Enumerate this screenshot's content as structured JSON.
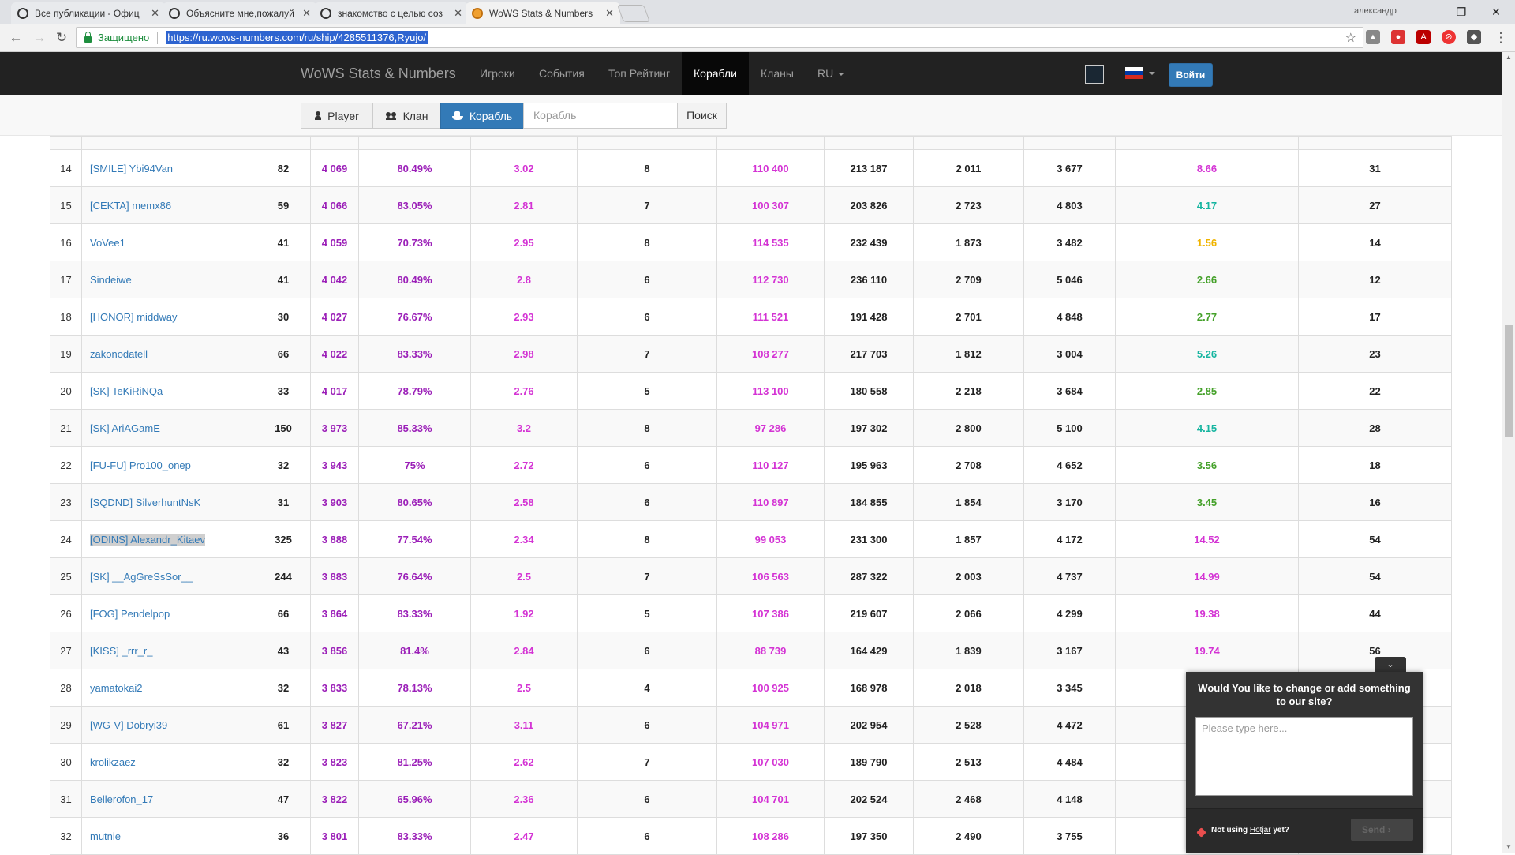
{
  "browser": {
    "tabs": [
      {
        "title": "Все публикации - Офиц",
        "favicon": "wows-icon"
      },
      {
        "title": "Объясните мне,пожалуй",
        "favicon": "wows-icon"
      },
      {
        "title": "знакомство с целью соз",
        "favicon": "wows-icon"
      },
      {
        "title": "WoWS Stats & Numbers",
        "favicon": "numbers-icon"
      }
    ],
    "user": "александр",
    "secure_label": "Защищено",
    "url": "https://ru.wows-numbers.com/ru/ship/4285511376,Ryujo/"
  },
  "site": {
    "brand": "WoWS Stats & Numbers",
    "nav": [
      "Игроки",
      "События",
      "Топ Рейтинг",
      "Корабли",
      "Кланы",
      "RU"
    ],
    "active_nav": "Корабли",
    "login": "Войти"
  },
  "search": {
    "player": "Player",
    "clan": "Клан",
    "ship": "Корабль",
    "placeholder": "Корабль",
    "go": "Поиск"
  },
  "table": {
    "rows": [
      {
        "rank": "14",
        "nick": "[SMILE] Ybi94Van",
        "battles": "82",
        "pr": "4 069",
        "wr": "80.49%",
        "frags": "3.02",
        "c5": "8",
        "dmg": "110 400",
        "c7": "213 187",
        "c8": "2 011",
        "c9": "3 677",
        "c10": "8.66",
        "c10_color": "#d433d4",
        "c11": "31"
      },
      {
        "rank": "15",
        "nick": "[CEKTA] memx86",
        "battles": "59",
        "pr": "4 066",
        "wr": "83.05%",
        "frags": "2.81",
        "c5": "7",
        "dmg": "100 307",
        "c7": "203 826",
        "c8": "2 723",
        "c9": "4 803",
        "c10": "4.17",
        "c10_color": "#16b5a0",
        "c11": "27"
      },
      {
        "rank": "16",
        "nick": "VoVee1",
        "battles": "41",
        "pr": "4 059",
        "wr": "70.73%",
        "frags": "2.95",
        "c5": "8",
        "dmg": "114 535",
        "c7": "232 439",
        "c8": "1 873",
        "c9": "3 482",
        "c10": "1.56",
        "c10_color": "#f0b400",
        "c11": "14"
      },
      {
        "rank": "17",
        "nick": "Sindeiwe",
        "battles": "41",
        "pr": "4 042",
        "wr": "80.49%",
        "frags": "2.8",
        "c5": "6",
        "dmg": "112 730",
        "c7": "236 110",
        "c8": "2 709",
        "c9": "5 046",
        "c10": "2.66",
        "c10_color": "#45a12a",
        "c11": "12"
      },
      {
        "rank": "18",
        "nick": "[HONOR] middway",
        "battles": "30",
        "pr": "4 027",
        "wr": "76.67%",
        "frags": "2.93",
        "c5": "6",
        "dmg": "111 521",
        "c7": "191 428",
        "c8": "2 701",
        "c9": "4 848",
        "c10": "2.77",
        "c10_color": "#45a12a",
        "c11": "17"
      },
      {
        "rank": "19",
        "nick": "zakonodatell",
        "battles": "66",
        "pr": "4 022",
        "wr": "83.33%",
        "frags": "2.98",
        "c5": "7",
        "dmg": "108 277",
        "c7": "217 703",
        "c8": "1 812",
        "c9": "3 004",
        "c10": "5.26",
        "c10_color": "#16b5a0",
        "c11": "23"
      },
      {
        "rank": "20",
        "nick": "[SK] TeKiRiNQa",
        "battles": "33",
        "pr": "4 017",
        "wr": "78.79%",
        "frags": "2.76",
        "c5": "5",
        "dmg": "113 100",
        "c7": "180 558",
        "c8": "2 218",
        "c9": "3 684",
        "c10": "2.85",
        "c10_color": "#45a12a",
        "c11": "22"
      },
      {
        "rank": "21",
        "nick": "[SK] AriAGamE",
        "battles": "150",
        "pr": "3 973",
        "wr": "85.33%",
        "frags": "3.2",
        "c5": "8",
        "dmg": "97 286",
        "c7": "197 302",
        "c8": "2 800",
        "c9": "5 100",
        "c10": "4.15",
        "c10_color": "#16b5a0",
        "c11": "28"
      },
      {
        "rank": "22",
        "nick": "[FU-FU] Pro100_onep",
        "battles": "32",
        "pr": "3 943",
        "wr": "75%",
        "frags": "2.72",
        "c5": "6",
        "dmg": "110 127",
        "c7": "195 963",
        "c8": "2 708",
        "c9": "4 652",
        "c10": "3.56",
        "c10_color": "#45a12a",
        "c11": "18"
      },
      {
        "rank": "23",
        "nick": "[SQDND] SilverhuntNsK",
        "battles": "31",
        "pr": "3 903",
        "wr": "80.65%",
        "frags": "2.58",
        "c5": "6",
        "dmg": "110 897",
        "c7": "184 855",
        "c8": "1 854",
        "c9": "3 170",
        "c10": "3.45",
        "c10_color": "#45a12a",
        "c11": "16"
      },
      {
        "rank": "24",
        "nick": "[ODINS] Alexandr_Kitaev",
        "battles": "325",
        "pr": "3 888",
        "wr": "77.54%",
        "frags": "2.34",
        "c5": "8",
        "dmg": "99 053",
        "c7": "231 300",
        "c8": "1 857",
        "c9": "4 172",
        "c10": "14.52",
        "c10_color": "#d433d4",
        "c11": "54",
        "highlight": true
      },
      {
        "rank": "25",
        "nick": "[SK] __AgGreSsSor__",
        "battles": "244",
        "pr": "3 883",
        "wr": "76.64%",
        "frags": "2.5",
        "c5": "7",
        "dmg": "106 563",
        "c7": "287 322",
        "c8": "2 003",
        "c9": "4 737",
        "c10": "14.99",
        "c10_color": "#d433d4",
        "c11": "54"
      },
      {
        "rank": "26",
        "nick": "[FOG] Pendelpop",
        "battles": "66",
        "pr": "3 864",
        "wr": "83.33%",
        "frags": "1.92",
        "c5": "5",
        "dmg": "107 386",
        "c7": "219 607",
        "c8": "2 066",
        "c9": "4 299",
        "c10": "19.38",
        "c10_color": "#d433d4",
        "c11": "44"
      },
      {
        "rank": "27",
        "nick": "[KISS] _rrr_r_",
        "battles": "43",
        "pr": "3 856",
        "wr": "81.4%",
        "frags": "2.84",
        "c5": "6",
        "dmg": "88 739",
        "c7": "164 429",
        "c8": "1 839",
        "c9": "3 167",
        "c10": "19.74",
        "c10_color": "#d433d4",
        "c11": "56"
      },
      {
        "rank": "28",
        "nick": "yamatokai2",
        "battles": "32",
        "pr": "3 833",
        "wr": "78.13%",
        "frags": "2.5",
        "c5": "4",
        "dmg": "100 925",
        "c7": "168 978",
        "c8": "2 018",
        "c9": "3 345",
        "c10": "",
        "c10_color": "#d433d4",
        "c11": ""
      },
      {
        "rank": "29",
        "nick": "[WG-V] Dobryi39",
        "battles": "61",
        "pr": "3 827",
        "wr": "67.21%",
        "frags": "3.11",
        "c5": "6",
        "dmg": "104 971",
        "c7": "202 954",
        "c8": "2 528",
        "c9": "4 472",
        "c10": "",
        "c10_color": "#d433d4",
        "c11": ""
      },
      {
        "rank": "30",
        "nick": "krolikzaez",
        "battles": "32",
        "pr": "3 823",
        "wr": "81.25%",
        "frags": "2.62",
        "c5": "7",
        "dmg": "107 030",
        "c7": "189 790",
        "c8": "2 513",
        "c9": "4 484",
        "c10": "",
        "c10_color": "#d433d4",
        "c11": ""
      },
      {
        "rank": "31",
        "nick": "Bellerofon_17",
        "battles": "47",
        "pr": "3 822",
        "wr": "65.96%",
        "frags": "2.36",
        "c5": "6",
        "dmg": "104 701",
        "c7": "202 524",
        "c8": "2 468",
        "c9": "4 148",
        "c10": "",
        "c10_color": "#d433d4",
        "c11": ""
      },
      {
        "rank": "32",
        "nick": "mutnie",
        "battles": "36",
        "pr": "3 801",
        "wr": "83.33%",
        "frags": "2.47",
        "c5": "6",
        "dmg": "108 286",
        "c7": "197 350",
        "c8": "2 490",
        "c9": "3 755",
        "c10": "",
        "c10_color": "#d433d4",
        "c11": ""
      }
    ]
  },
  "hotjar": {
    "title": "Would You like to change or add something to our site?",
    "placeholder": "Please type here...",
    "note_prefix": "Not using ",
    "note_link": "Hotjar",
    "note_suffix": " yet?",
    "send": "Send"
  }
}
